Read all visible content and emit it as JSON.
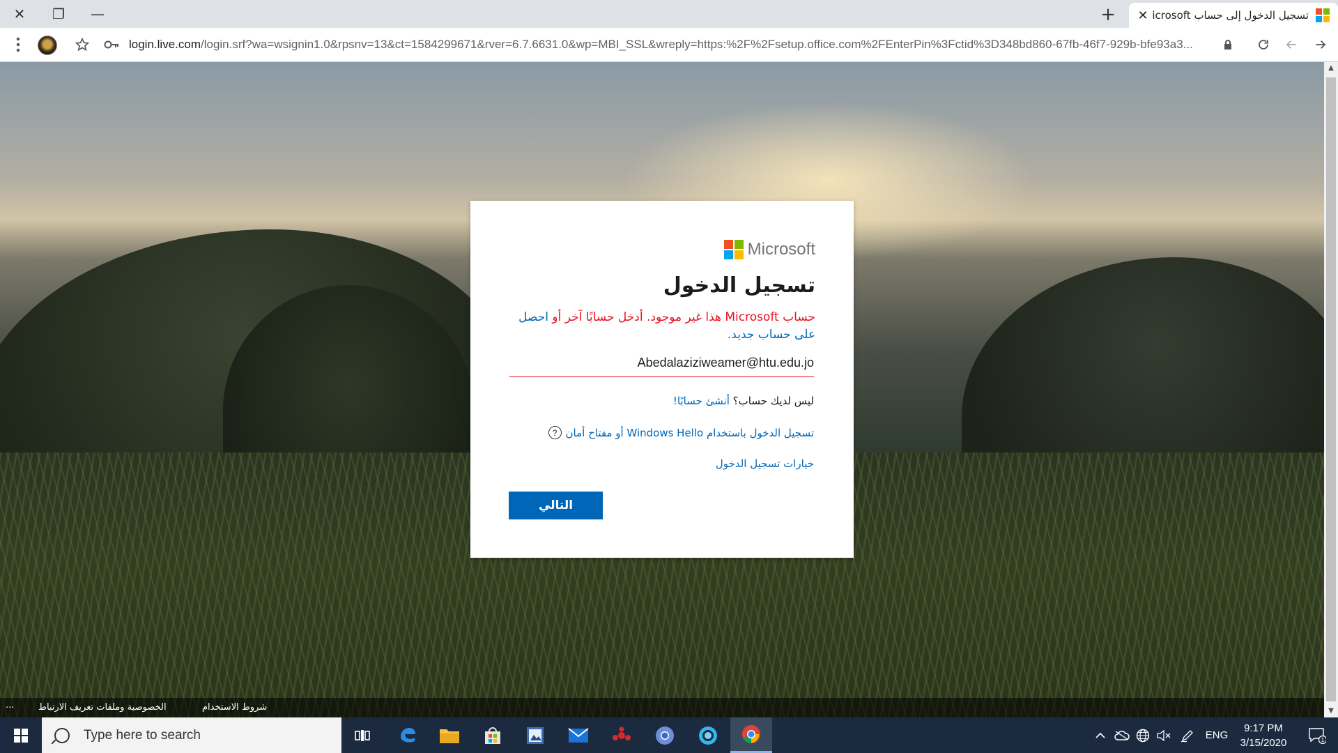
{
  "window": {
    "close": "✕",
    "restore": "❐",
    "minimize": "—"
  },
  "tab": {
    "title": "تسجيل الدخول إلى حساب Microsoft",
    "close": "✕",
    "new_tab": "+"
  },
  "toolbar": {
    "url_host": "login.live.com",
    "url_path": "/login.srf?wa=wsignin1.0&rpsnv=13&ct=1584299671&rver=6.7.6631.0&wp=MBI_SSL&wreply=https:%2F%2Fsetup.office.com%2FEnterPin%3Fctid%3D348bd860-67fb-46f7-929b-bfe93a3..."
  },
  "card": {
    "brand": "Microsoft",
    "title": "تسجيل الدخول",
    "error_text": "حساب Microsoft هذا غير موجود. أدخل حسابًا آخر أو",
    "error_link": "احصل على حساب جديد",
    "error_end": ".",
    "email_value": "Abedalaziziweamer@htu.edu.jo",
    "no_account": "ليس لديك حساب؟",
    "create_account": "أنشئ حسابًا!",
    "windows_hello": "تسجيل الدخول باستخدام Windows Hello أو مفتاح أمان",
    "help": "?",
    "signin_options": "خيارات تسجيل الدخول",
    "next_button": "التالي"
  },
  "footer": {
    "terms": "شروط الاستخدام",
    "privacy": "الخصوصية وملفات تعريف الارتباط",
    "more": "..."
  },
  "taskbar": {
    "search_placeholder": "Type here to search",
    "language": "ENG",
    "time": "9:17 PM",
    "date": "3/15/2020",
    "notification_count": "1"
  },
  "colors": {
    "ms_red": "#f25022",
    "ms_green": "#7fba00",
    "ms_blue": "#00a4ef",
    "ms_yellow": "#ffb900",
    "primary_button": "#0067b8",
    "error": "#e81123"
  }
}
